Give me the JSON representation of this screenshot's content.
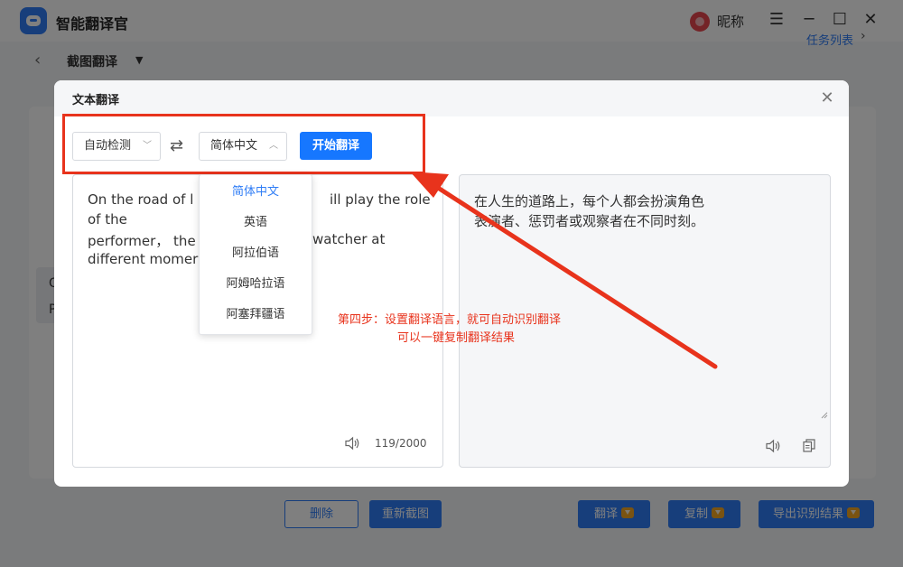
{
  "app": {
    "title": "智能翻译官",
    "user_name": "昵称",
    "window_controls": [
      "☰",
      "─",
      "☐",
      "✕"
    ],
    "breadcrumb": "截图翻译",
    "task_list": "任务列表",
    "peek_left": [
      "O",
      "P"
    ],
    "peek_right": "e"
  },
  "bottom_buttons": {
    "delete": "删除",
    "recapture": "重新截图",
    "translate": "翻译",
    "copy": "复制",
    "export": "导出识别结果"
  },
  "modal": {
    "title": "文本翻译",
    "source_lang": "自动检测",
    "target_lang": "简体中文",
    "start_button": "开始翻译",
    "source_lines": [
      "On the road of l",
      "ill play the role",
      "of the",
      "performer， the",
      "watcher at",
      "different momer"
    ],
    "char_count": "119/2000",
    "target_lines": [
      "在人生的道路上，每个人都会扮演角色",
      "表演者、惩罚者或观察者在不同时刻。"
    ],
    "dropdown_options": [
      "简体中文",
      "英语",
      "阿拉伯语",
      "阿姆哈拉语",
      "阿塞拜疆语"
    ]
  },
  "annotation": {
    "line1": "第四步：设置翻译语言，就可自动识别翻译",
    "line2": "可以一键复制翻译结果",
    "color": "#e8331c"
  },
  "colors": {
    "accent": "#1677ff",
    "annotation_red": "#e8331c"
  }
}
